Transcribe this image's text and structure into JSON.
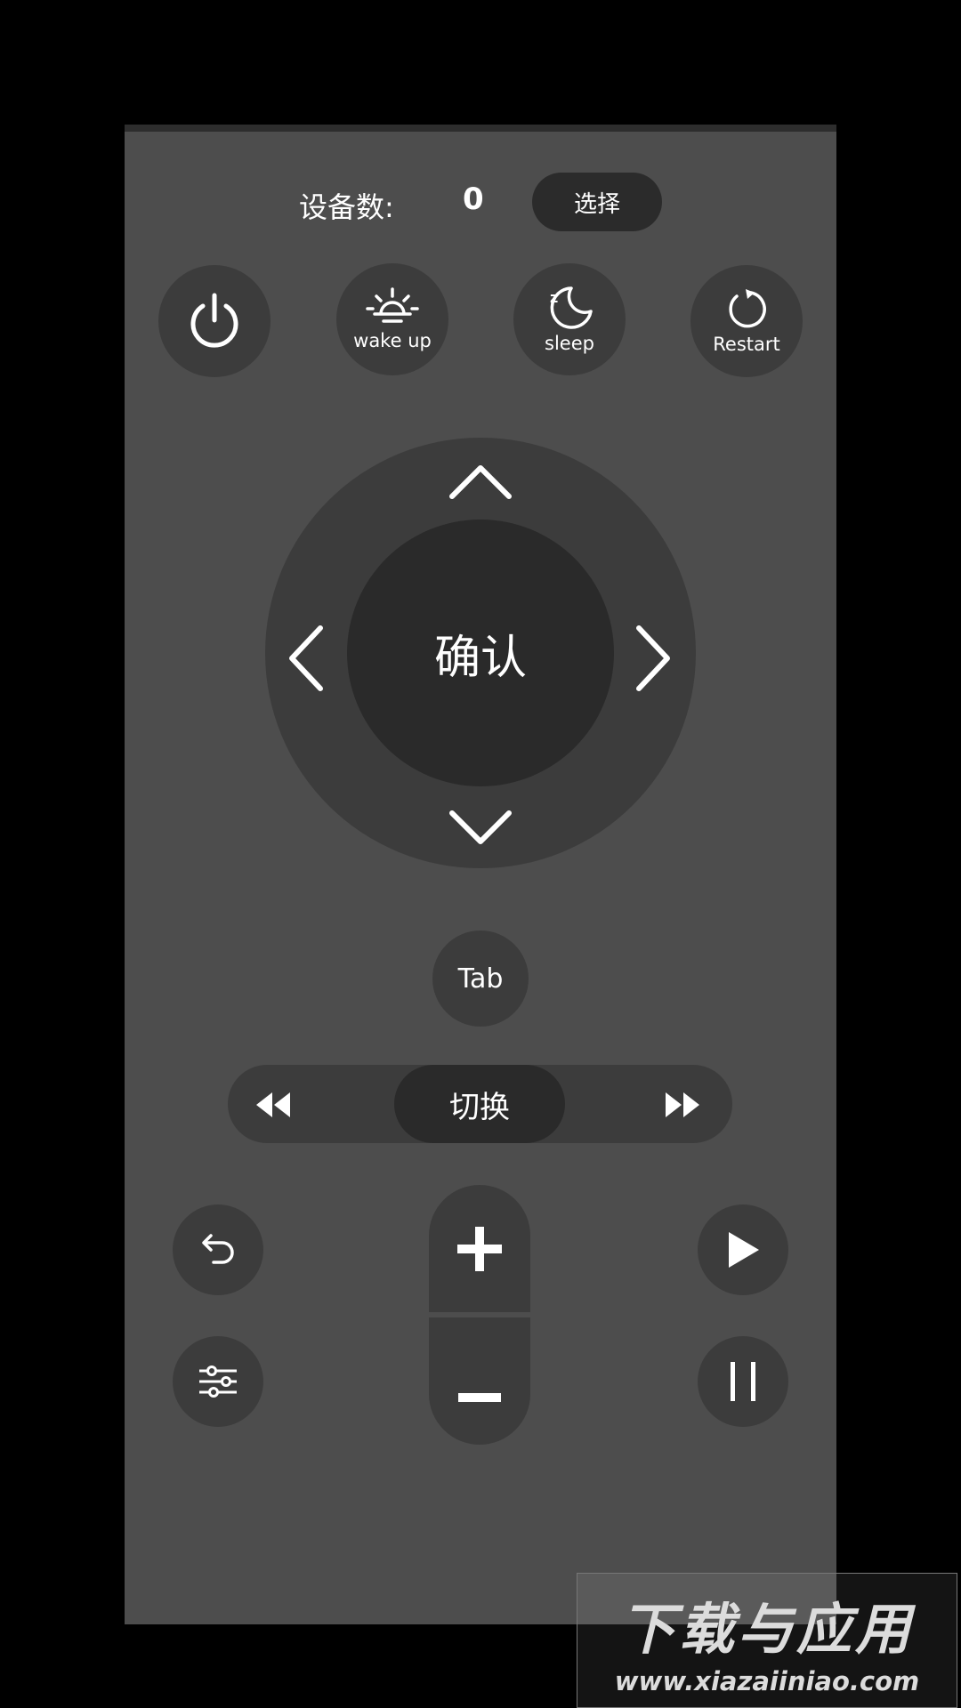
{
  "header": {
    "device_label": "设备数:",
    "device_count": "0",
    "select_label": "选择"
  },
  "power_row": {
    "power_icon": "power-icon",
    "wake_label": "wake up",
    "sleep_label": "sleep",
    "restart_label": "Restart"
  },
  "dpad": {
    "ok_label": "确认",
    "icons": [
      "chevron-up-icon",
      "chevron-down-icon",
      "chevron-left-icon",
      "chevron-right-icon"
    ]
  },
  "tab_label": "Tab",
  "switch": {
    "label": "切换",
    "rewind_icon": "rewind-icon",
    "fast_forward_icon": "fast-forward-icon"
  },
  "controls": {
    "back_icon": "back-arrow-icon",
    "settings_icon": "sliders-icon",
    "volume_up_icon": "plus-icon",
    "volume_down_icon": "minus-icon",
    "play_icon": "play-icon",
    "pause_icon": "pause-icon"
  },
  "watermark": {
    "title": "下载与应用",
    "url": "www.xiazaiiniao.com"
  },
  "colors": {
    "background": "#000000",
    "panel": "#4d4d4d",
    "button": "#3c3c3c",
    "button_dark": "#2a2a2a",
    "text": "#ffffff"
  }
}
